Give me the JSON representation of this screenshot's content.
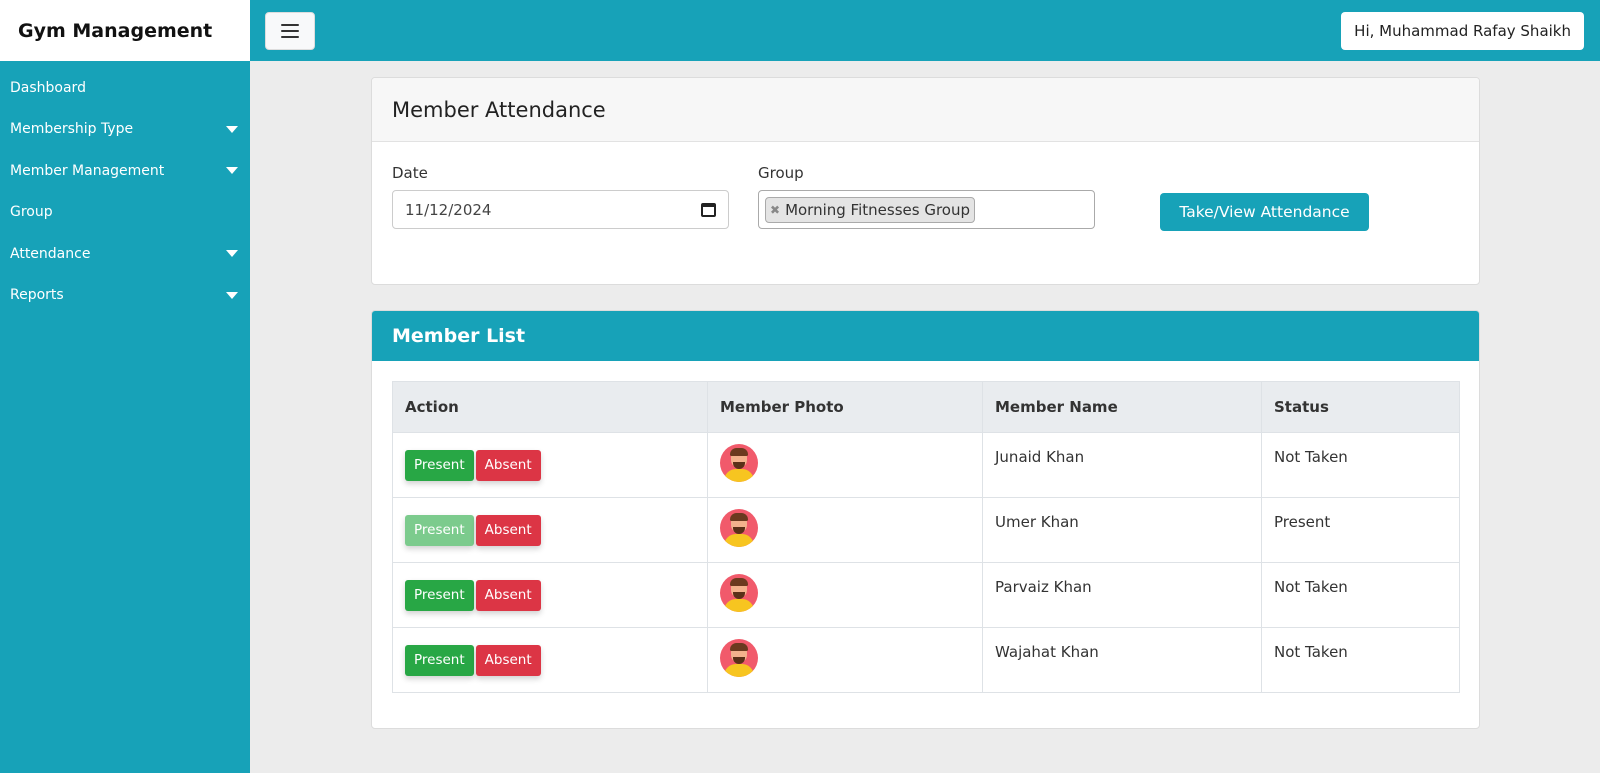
{
  "app": {
    "brand": "Gym Management"
  },
  "header": {
    "user_greeting": "Hi, Muhammad Rafay Shaikh"
  },
  "sidebar": {
    "items": [
      {
        "label": "Dashboard",
        "has_submenu": false
      },
      {
        "label": "Membership Type",
        "has_submenu": true
      },
      {
        "label": "Member Management",
        "has_submenu": true
      },
      {
        "label": "Group",
        "has_submenu": false
      },
      {
        "label": "Attendance",
        "has_submenu": true
      },
      {
        "label": "Reports",
        "has_submenu": true
      }
    ]
  },
  "attendance_form": {
    "title": "Member Attendance",
    "date_label": "Date",
    "date_value": "11/12/2024",
    "group_label": "Group",
    "group_selected": "Morning Fitnesses Group",
    "submit_label": "Take/View Attendance"
  },
  "member_list": {
    "title": "Member List",
    "columns": [
      "Action",
      "Member Photo",
      "Member Name",
      "Status"
    ],
    "present_label": "Present",
    "absent_label": "Absent",
    "rows": [
      {
        "name": "Junaid Khan",
        "status": "Not Taken",
        "present_disabled": false
      },
      {
        "name": "Umer Khan",
        "status": "Present",
        "present_disabled": true
      },
      {
        "name": "Parvaiz Khan",
        "status": "Not Taken",
        "present_disabled": false
      },
      {
        "name": "Wajahat Khan",
        "status": "Not Taken",
        "present_disabled": false
      }
    ]
  },
  "colors": {
    "primary": "#17a2b8",
    "success": "#28a745",
    "danger": "#dc3545"
  }
}
